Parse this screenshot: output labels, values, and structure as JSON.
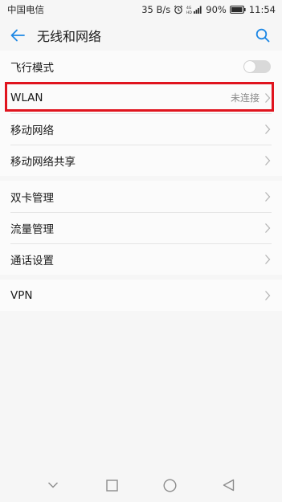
{
  "status_bar": {
    "carrier": "中国电信",
    "speed": "35 B/s",
    "battery": "90%",
    "time": "11:54",
    "icons": [
      "alarm-icon",
      "signal-icon",
      "battery-icon"
    ]
  },
  "header": {
    "title": "无线和网络",
    "back_icon": "back-arrow-icon",
    "search_icon": "search-icon"
  },
  "settings": {
    "group1": [
      {
        "label": "飞行模式",
        "type": "toggle",
        "state": "off"
      },
      {
        "label": "WLAN",
        "value": "未连接",
        "type": "link",
        "highlighted": true
      },
      {
        "label": "移动网络",
        "type": "link"
      },
      {
        "label": "移动网络共享",
        "type": "link"
      }
    ],
    "group2": [
      {
        "label": "双卡管理",
        "type": "link"
      },
      {
        "label": "流量管理",
        "type": "link"
      },
      {
        "label": "通话设置",
        "type": "link"
      }
    ],
    "group3": [
      {
        "label": "VPN",
        "type": "link"
      }
    ]
  },
  "nav_bar": {
    "buttons": [
      "collapse-icon",
      "recents-icon",
      "home-icon",
      "back-triangle-icon"
    ]
  },
  "colors": {
    "accent": "#1e88e5",
    "highlight": "#e0141e",
    "background": "#f6f6f6"
  }
}
